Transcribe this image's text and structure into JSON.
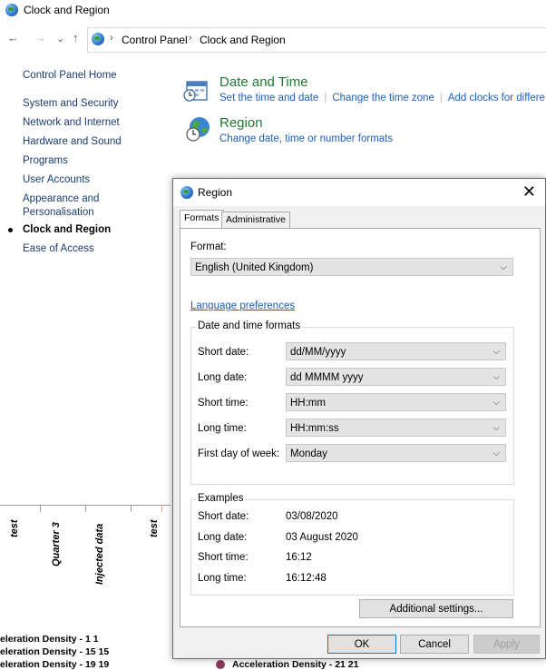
{
  "window": {
    "title": "Clock and Region"
  },
  "nav": {
    "back": "←",
    "forward": "→",
    "recent": "⌄",
    "up": "↑"
  },
  "address": {
    "crumbs": [
      "Control Panel",
      "Clock and Region"
    ]
  },
  "sidebar": {
    "home": "Control Panel Home",
    "items": [
      {
        "label": "System and Security"
      },
      {
        "label": "Network and Internet"
      },
      {
        "label": "Hardware and Sound"
      },
      {
        "label": "Programs"
      },
      {
        "label": "User Accounts"
      },
      {
        "label": "Appearance and"
      },
      {
        "label": "Personalisation"
      },
      {
        "label": "Clock and Region"
      },
      {
        "label": "Ease of Access"
      }
    ]
  },
  "categories": {
    "datetime": {
      "title": "Date and Time",
      "links": [
        "Set the time and date",
        "Change the time zone",
        "Add clocks for differe"
      ]
    },
    "region": {
      "title": "Region",
      "links": [
        "Change date, time or number formats"
      ]
    }
  },
  "background_chart": {
    "x_labels": [
      "test",
      "Quarter 3",
      "Injected data",
      "test"
    ],
    "legend": [
      "eleration Density - 1 1",
      "eleration Density - 15 15",
      "eleration Density - 19 19",
      "Acceleration Density - 21 21"
    ]
  },
  "dialog": {
    "title": "Region",
    "close": "✕",
    "tabs": [
      "Formats",
      "Administrative"
    ],
    "format_label": "Format:",
    "format_value": "English (United Kingdom)",
    "language_link": "Language preferences",
    "dt_group_title": "Date and time formats",
    "fields": [
      {
        "label": "Short date:",
        "value": "dd/MM/yyyy"
      },
      {
        "label": "Long date:",
        "value": "dd MMMM yyyy"
      },
      {
        "label": "Short time:",
        "value": "HH:mm"
      },
      {
        "label": "Long time:",
        "value": "HH:mm:ss"
      },
      {
        "label": "First day of week:",
        "value": "Monday"
      }
    ],
    "examples_title": "Examples",
    "examples": [
      {
        "label": "Short date:",
        "value": "03/08/2020"
      },
      {
        "label": "Long date:",
        "value": "03 August 2020"
      },
      {
        "label": "Short time:",
        "value": "16:12"
      },
      {
        "label": "Long time:",
        "value": "16:12:48"
      }
    ],
    "additional_settings": "Additional settings...",
    "ok": "OK",
    "cancel": "Cancel",
    "apply": "Apply"
  }
}
